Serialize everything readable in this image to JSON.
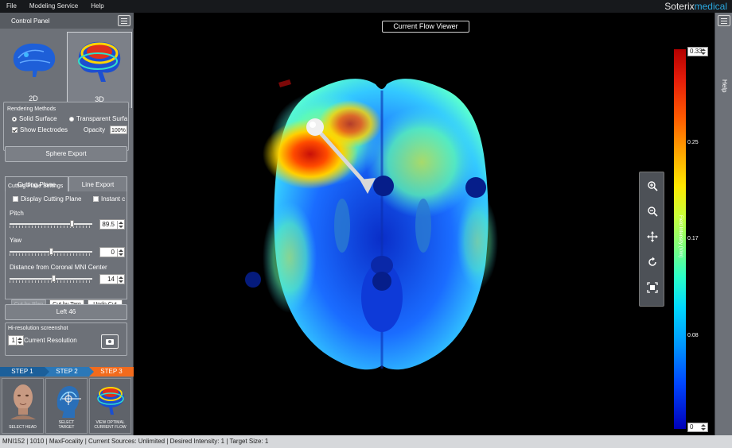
{
  "menu": {
    "file": "File",
    "modeling_service": "Modeling Service",
    "help": "Help"
  },
  "brand": {
    "part1": "Soterix",
    "part2": "medical"
  },
  "control_panel": {
    "title": "Control Panel",
    "tab_2d": "2D",
    "tab_3d": "3D",
    "rendering": {
      "title": "Rendering Methods",
      "solid_surface": "Solid Surface",
      "transparent_surface": "Transparent Surfa",
      "show_electrodes": "Show Electrodes",
      "opacity_label": "Opacity",
      "opacity_value": "100%"
    },
    "sphere_export": "Sphere Export",
    "subtabs": {
      "cutting_plane": "Cutting Plane",
      "line_export": "Line Export"
    },
    "cutting": {
      "title": "Cutting Plane Settings",
      "display_cutting_plane": "Display Cutting Plane",
      "instant": "Instant c",
      "pitch_label": "Pitch",
      "pitch_value": "89.5",
      "yaw_label": "Yaw",
      "yaw_value": "0",
      "distance_label": "Distance from Coronal MNI Center",
      "distance_value": "14",
      "cut_by_plane": "Cut by Plan",
      "cut_by_target": "Cut by Targ",
      "undo_cut": "Undo Cut"
    },
    "left_button": "Left 46",
    "screenshot": {
      "title": "Hi-resolution screenshot",
      "multiplier": "1",
      "label": "Current Resolution"
    }
  },
  "steps": {
    "step1": "STEP 1",
    "step2": "STEP 2",
    "step3": "STEP 3",
    "select_head": "SELECT HEAD",
    "select_target_1": "SELECT",
    "select_target_2": "TARGET",
    "view_flow_1": "VIEW OPTIMAL",
    "view_flow_2": "CURRENT FLOW"
  },
  "viewer": {
    "title": "Current Flow Viewer",
    "tools": [
      "zoom-in-icon",
      "zoom-out-icon",
      "move-icon",
      "rotate-icon",
      "fit-screen-icon"
    ]
  },
  "colorbar": {
    "max_value": "0.33",
    "min_value": "0",
    "ticks": [
      "0.25",
      "0.17",
      "0.08"
    ],
    "axis_label": "Field Intensity (V/m)",
    "colors": [
      "#b30000",
      "#ffa400",
      "#ffe800",
      "#2affc8",
      "#0096ff",
      "#0000b8"
    ]
  },
  "helpbar": {
    "label": "Help"
  },
  "status": {
    "text": "MNI152 | 1010 | MaxFocality | Current Sources: Unlimited | Desired Intensity: 1 | Target Size: 1"
  }
}
